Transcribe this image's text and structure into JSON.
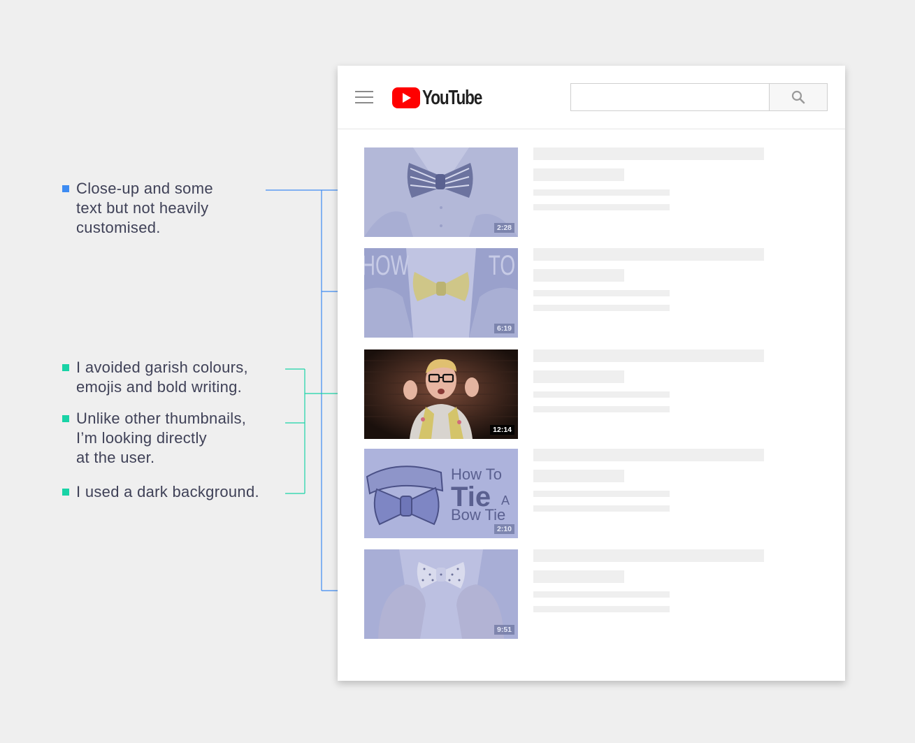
{
  "annotations": {
    "a1": [
      "Close-up and some",
      "text but not heavily",
      "customised."
    ],
    "a2": [
      "I avoided garish colours,",
      "emojis and bold writing."
    ],
    "a3": [
      "Unlike other thumbnails,",
      "I’m looking directly",
      "at the user."
    ],
    "a4": [
      "I used a dark background."
    ]
  },
  "colors": {
    "blue_marker": "#3d8bf2",
    "teal_marker": "#19d3a6",
    "youtube_red": "#ff0000"
  },
  "header": {
    "menu_icon": "hamburger-menu-icon",
    "logo_text": "YouTube",
    "search_placeholder": "",
    "search_icon": "search-icon"
  },
  "videos": [
    {
      "duration": "2:28"
    },
    {
      "duration": "6:19",
      "overlay_left": "HOW",
      "overlay_right": "TO"
    },
    {
      "duration": "12:14"
    },
    {
      "duration": "2:10",
      "line1": "How To",
      "line2a": "Tie",
      "line2b": "A",
      "line3": "Bow Tie"
    },
    {
      "duration": "9:51"
    }
  ]
}
